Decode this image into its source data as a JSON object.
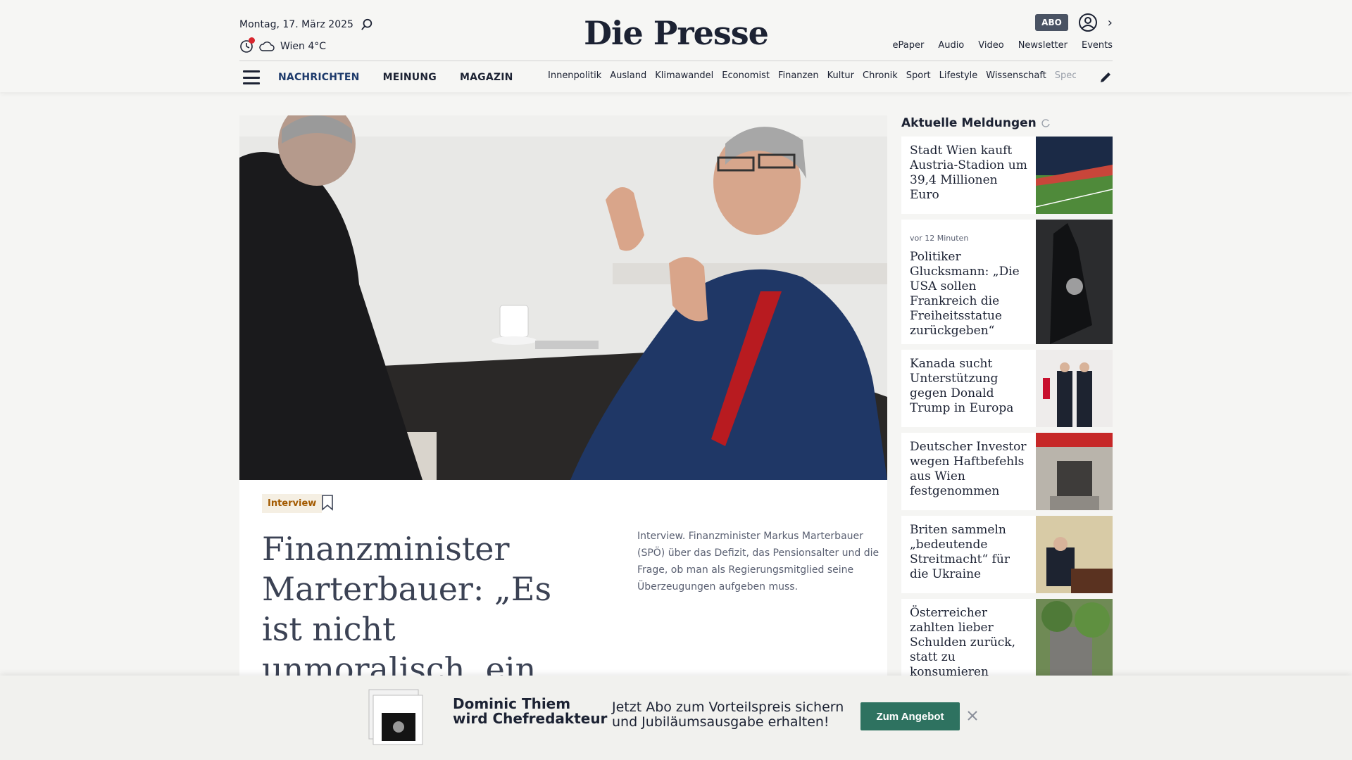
{
  "header": {
    "date": "Montag, 17. März 2025",
    "weather": "Wien 4°C",
    "logo": "Die Presse",
    "abo_label": "ABO",
    "top_links": [
      "ePaper",
      "Audio",
      "Video",
      "Newsletter",
      "Events"
    ],
    "main_nav": [
      "NACHRICHTEN",
      "MEINUNG",
      "MAGAZIN"
    ],
    "sub_nav": [
      "Innenpolitik",
      "Ausland",
      "Klimawandel",
      "Economist",
      "Finanzen",
      "Kultur",
      "Chronik",
      "Sport",
      "Lifestyle",
      "Wissenschaft",
      "Spectr"
    ]
  },
  "article": {
    "tag": "Interview",
    "headline": "Finanzminister Marterbauer: „Es ist nicht unmoralisch, ein großes Vermögen",
    "lead": "Interview. Finanzminister Markus Marterbauer (SPÖ) über das Defizit, das Pensionsalter und die Frage, ob man als Regierungsmitglied seine Überzeugungen aufgeben muss."
  },
  "sidebar": {
    "title": "Aktuelle Meldungen",
    "items": [
      {
        "meta": "",
        "headline": "Stadt Wien kauft Austria-Stadion um 39,4 Millionen Euro"
      },
      {
        "meta": "vor 12 Minuten",
        "headline": "Politiker Glucksmann: „Die USA sollen Frankreich die Freiheitsstatue zurückgeben“"
      },
      {
        "meta": "",
        "headline": "Kanada sucht Unterstützung gegen Donald Trump in Europa"
      },
      {
        "meta": "",
        "headline": "Deutscher Investor wegen Haftbefehls aus Wien festgenommen"
      },
      {
        "meta": "",
        "headline": "Briten sammeln „bedeutende Streitmacht“ für die Ukraine"
      },
      {
        "meta": "",
        "headline": "Österreicher zahlten lieber Schulden zurück, statt zu konsumieren"
      }
    ]
  },
  "promo": {
    "title_line1": "Dominic Thiem",
    "title_line2": "wird Chefredakteur",
    "text_line1": "Jetzt Abo zum Vorteilspreis sichern",
    "text_line2": "und Jubiläumsausgabe erhalten!",
    "button": "Zum Angebot"
  }
}
